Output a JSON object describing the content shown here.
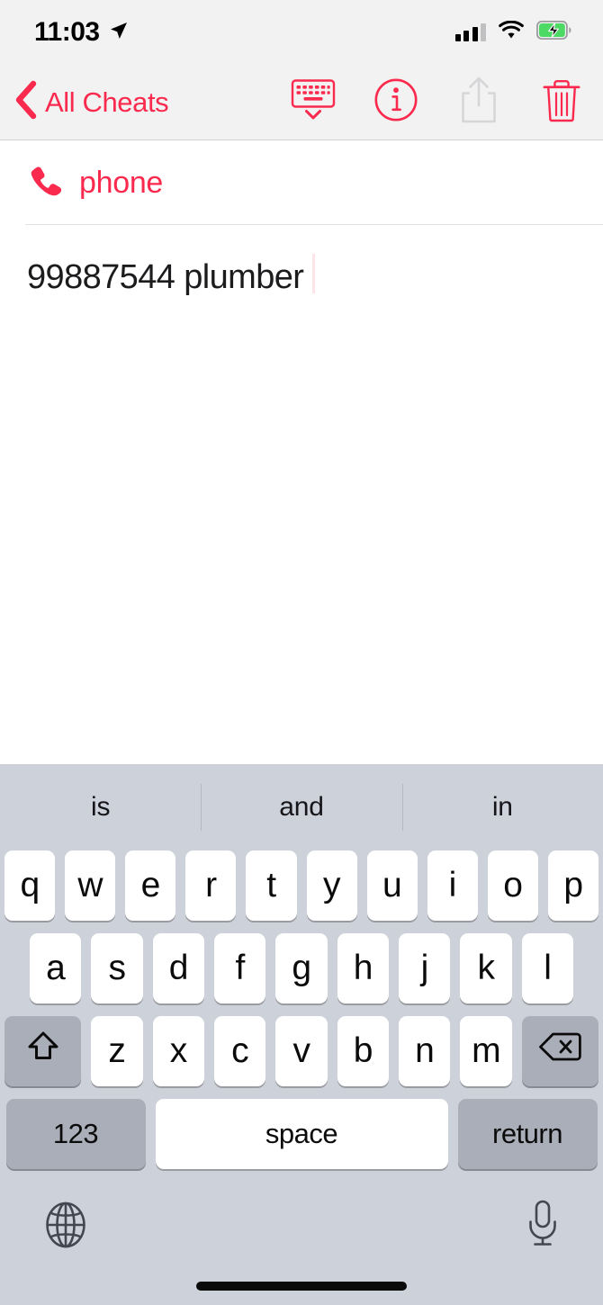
{
  "status_bar": {
    "time": "11:03",
    "location_icon": "location-arrow-icon",
    "signal_icon": "cellular-signal-icon",
    "signal_bars_filled": 3,
    "signal_bars_total": 4,
    "wifi_icon": "wifi-icon",
    "battery_icon": "battery-charging-icon",
    "battery_color": "#4cd964",
    "battery_charging": true
  },
  "nav_bar": {
    "back_label": "All Cheats",
    "back_chevron_icon": "chevron-left-icon",
    "accent_color": "#fa2a4e",
    "actions": [
      {
        "name": "hide-keyboard-button",
        "icon": "keyboard-dismiss-icon",
        "enabled": true
      },
      {
        "name": "info-button",
        "icon": "info-circle-icon",
        "enabled": true
      },
      {
        "name": "share-button",
        "icon": "share-icon",
        "enabled": false
      },
      {
        "name": "delete-button",
        "icon": "trash-icon",
        "enabled": true
      }
    ]
  },
  "content": {
    "category_icon": "phone-handset-icon",
    "category_title": "phone",
    "note_text": "99887544 plumber",
    "caret_visible": true
  },
  "keyboard": {
    "predictions": [
      "is",
      "and",
      "in"
    ],
    "row1": [
      "q",
      "w",
      "e",
      "r",
      "t",
      "y",
      "u",
      "i",
      "o",
      "p"
    ],
    "row2": [
      "a",
      "s",
      "d",
      "f",
      "g",
      "h",
      "j",
      "k",
      "l"
    ],
    "row3_letters": [
      "z",
      "x",
      "c",
      "v",
      "b",
      "n",
      "m"
    ],
    "shift_icon": "shift-arrow-icon",
    "backspace_icon": "backspace-delete-icon",
    "numeric_label": "123",
    "space_label": "space",
    "return_label": "return",
    "globe_icon": "globe-language-icon",
    "mic_icon": "microphone-icon",
    "background_color": "#cdd1d9",
    "key_color": "#ffffff",
    "special_key_color": "#a9aeb8"
  },
  "home_indicator": {
    "name": "home-indicator"
  }
}
